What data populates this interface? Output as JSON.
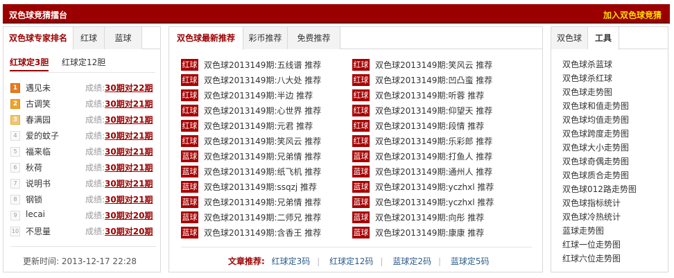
{
  "header": {
    "title": "双色球竞猜擂台",
    "join_link": "加入双色球竞猜"
  },
  "left": {
    "tabs": [
      "双色球专家排名",
      "红球",
      "蓝球"
    ],
    "subtabs": [
      "红球定3胆",
      "红球定12胆"
    ],
    "perf_label": "成绩:",
    "rankings": [
      {
        "rank": "1",
        "name": "遇见未",
        "result": "30期对22期"
      },
      {
        "rank": "2",
        "name": "古调笑",
        "result": "30期对21期"
      },
      {
        "rank": "3",
        "name": "春满园",
        "result": "30期对21期"
      },
      {
        "rank": "4",
        "name": "爱的蚊子",
        "result": "30期对21期"
      },
      {
        "rank": "5",
        "name": "福来临",
        "result": "30期对21期"
      },
      {
        "rank": "6",
        "name": "秋荷",
        "result": "30期对21期"
      },
      {
        "rank": "7",
        "name": "说明书",
        "result": "30期对21期"
      },
      {
        "rank": "8",
        "name": "钢锁",
        "result": "30期对21期"
      },
      {
        "rank": "9",
        "name": "lecai",
        "result": "30期对20期"
      },
      {
        "rank": "10",
        "name": "不思量",
        "result": "30期对20期"
      }
    ],
    "update_label": "更新时间:",
    "update_time": "2013-12-17 22:28"
  },
  "middle": {
    "tabs": [
      "双色球最新推荐",
      "彩币推荐",
      "免费推荐"
    ],
    "column_left": [
      {
        "ball": "红球",
        "text": "双色球2013149期:五线谱 推荐"
      },
      {
        "ball": "红球",
        "text": "双色球2013149期:八大处 推荐"
      },
      {
        "ball": "红球",
        "text": "双色球2013149期:半边 推荐"
      },
      {
        "ball": "红球",
        "text": "双色球2013149期:心世界 推荐"
      },
      {
        "ball": "红球",
        "text": "双色球2013149期:元君 推荐"
      },
      {
        "ball": "红球",
        "text": "双色球2013149期:笑风云 推荐"
      },
      {
        "ball": "蓝球",
        "text": "双色球2013149期:兄弟情 推荐"
      },
      {
        "ball": "蓝球",
        "text": "双色球2013149期:纸飞机 推荐"
      },
      {
        "ball": "蓝球",
        "text": "双色球2013149期:ssqzj 推荐"
      },
      {
        "ball": "蓝球",
        "text": "双色球2013149期:兄弟情 推荐"
      },
      {
        "ball": "蓝球",
        "text": "双色球2013149期:二师兄 推荐"
      },
      {
        "ball": "蓝球",
        "text": "双色球2013149期:含香王 推荐"
      }
    ],
    "column_right": [
      {
        "ball": "红球",
        "text": "双色球2013149期:笑风云 推荐"
      },
      {
        "ball": "红球",
        "text": "双色球2013149期:凹凸蛮 推荐"
      },
      {
        "ball": "红球",
        "text": "双色球2013149期:听蓉 推荐"
      },
      {
        "ball": "红球",
        "text": "双色球2013149期:仰望天 推荐"
      },
      {
        "ball": "红球",
        "text": "双色球2013149期:段情 推荐"
      },
      {
        "ball": "红球",
        "text": "双色球2013149期:乐彩郎 推荐"
      },
      {
        "ball": "蓝球",
        "text": "双色球2013149期:打鱼人 推荐"
      },
      {
        "ball": "蓝球",
        "text": "双色球2013149期:通州人 推荐"
      },
      {
        "ball": "蓝球",
        "text": "双色球2013149期:yczhxl 推荐"
      },
      {
        "ball": "蓝球",
        "text": "双色球2013149期:yczhxl 推荐"
      },
      {
        "ball": "蓝球",
        "text": "双色球2013149期:向彤 推荐"
      },
      {
        "ball": "蓝球",
        "text": "双色球2013149期:康康 推荐"
      }
    ],
    "articles_label": "文章推荐:",
    "articles": [
      "红球定3码",
      "红球定12码",
      "蓝球定2码",
      "蓝球定5码"
    ]
  },
  "right": {
    "tabs": [
      "双色球",
      "工具"
    ],
    "tools": [
      "双色球杀蓝球",
      "双色球杀红球",
      "双色球走势图",
      "双色球和值走势图",
      "双色球均值走势图",
      "双色球跨度走势图",
      "双色球大小走势图",
      "双色球奇偶走势图",
      "双色球质合走势图",
      "双色球012路走势图",
      "双色球指标统计",
      "双色球冷热统计",
      "蓝球走势图",
      "红球一位走势图",
      "红球六位走势图"
    ]
  },
  "colors": {
    "brand_red": "#9b0000",
    "ball_red": "#a80000",
    "join_yellow": "#ffde00",
    "link_blue": "#2a5b8c"
  }
}
